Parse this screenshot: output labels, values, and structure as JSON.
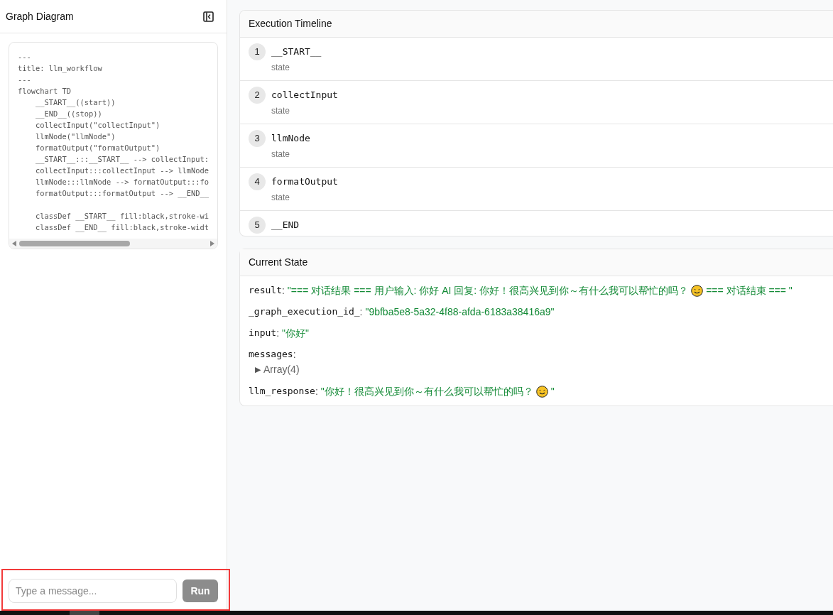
{
  "sidebar": {
    "title": "Graph Diagram",
    "code_lines": [
      "---",
      "title: llm_workflow",
      "---",
      "flowchart TD",
      "    __START__((start))",
      "    __END__((stop))",
      "    collectInput(\"collectInput\")",
      "    llmNode(\"llmNode\")",
      "    formatOutput(\"formatOutput\")",
      "    __START__:::__START__ --> collectInput:",
      "    collectInput:::collectInput --> llmNode",
      "    llmNode:::llmNode --> formatOutput:::fo",
      "    formatOutput:::formatOutput --> __END__",
      {
        "text": "    classDef __START__ fill:black,stroke-wi",
        "space_before": true
      },
      "    classDef __END__ fill:black,stroke-widt"
    ],
    "message": {
      "placeholder": "Type a message...",
      "button": "Run",
      "disabled": true
    }
  },
  "timeline": {
    "title": "Execution Timeline",
    "steps": [
      {
        "number": "1",
        "node": "__START__",
        "label": "state"
      },
      {
        "number": "2",
        "node": "collectInput",
        "label": "state"
      },
      {
        "number": "3",
        "node": "llmNode",
        "label": "state"
      },
      {
        "number": "4",
        "node": "formatOutput",
        "label": "state"
      },
      {
        "number": "5",
        "node": "__END"
      }
    ]
  },
  "current_state": {
    "title": "Current State",
    "separator": ":",
    "entries": [
      {
        "key": "result",
        "kind": "string",
        "parts": [
          {
            "kind": "text",
            "text": "\"=== 对话结果 === 用户输入: 你好 AI 回复: 你好！很高兴见到你～有什么我可以帮忙的吗？"
          },
          {
            "kind": "emoji"
          },
          {
            "kind": "text",
            "text": "=== 对话结束 === \""
          }
        ]
      },
      {
        "key": "_graph_execution_id_",
        "kind": "string",
        "parts": [
          {
            "kind": "text",
            "text": "\"9bfba5e8-5a32-4f88-afda-6183a38416a9\""
          }
        ]
      },
      {
        "key": "input",
        "kind": "string",
        "parts": [
          {
            "kind": "text",
            "text": "\"你好\""
          }
        ]
      },
      {
        "key": "messages",
        "kind": "array",
        "toggle": "▶",
        "summary": "Array(4)",
        "expanded": false
      },
      {
        "key": "llm_response",
        "kind": "string",
        "parts": [
          {
            "kind": "text",
            "text": "\"你好！很高兴见到你～有什么我可以帮忙的吗？"
          },
          {
            "kind": "emoji"
          },
          {
            "kind": "text",
            "text": "\""
          }
        ]
      }
    ]
  }
}
